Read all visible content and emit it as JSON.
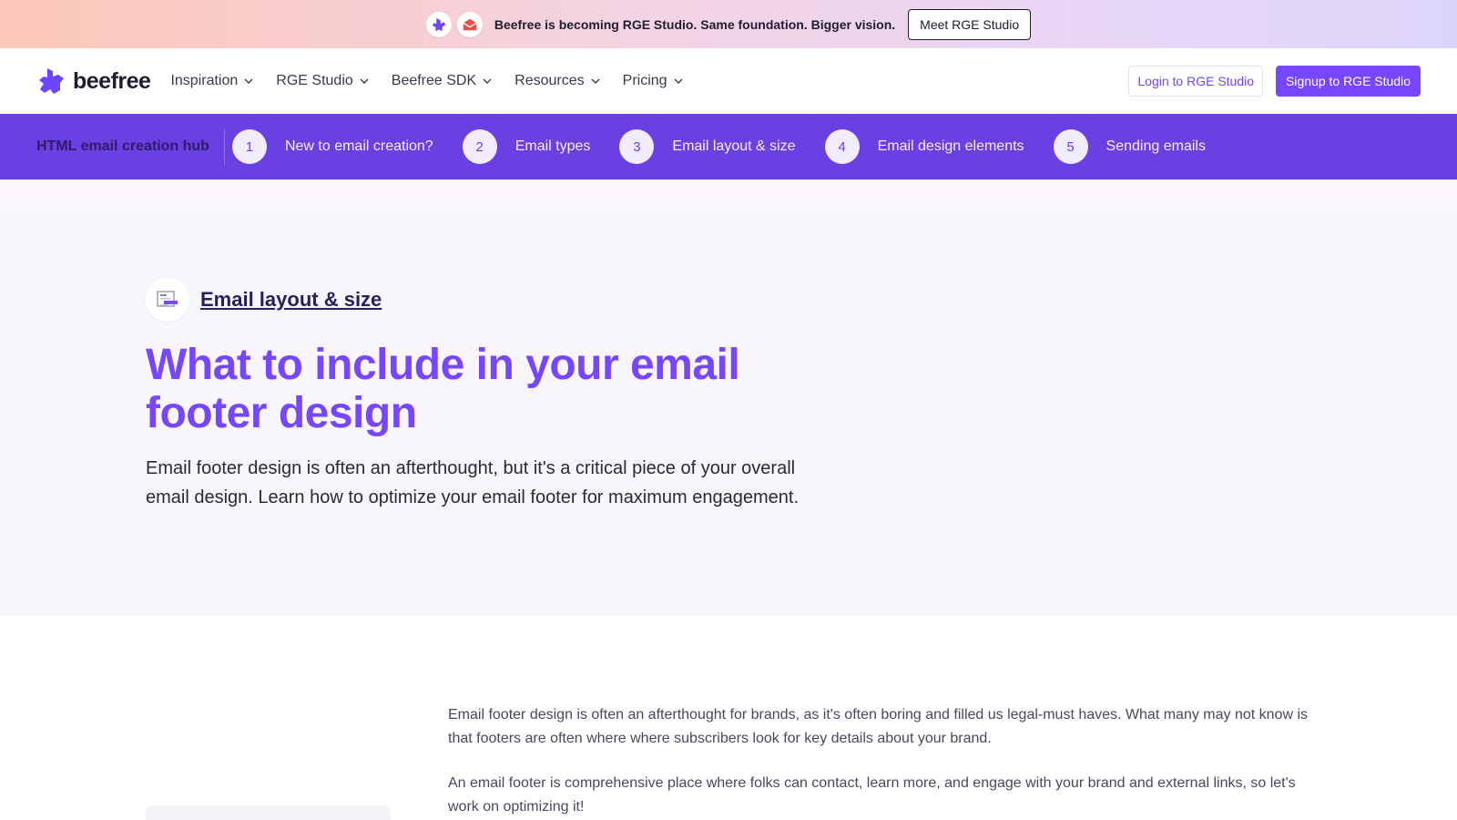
{
  "announcement": {
    "message": "Beefree is becoming RGE Studio. Same foundation. Bigger vision.",
    "cta": "Meet RGE Studio"
  },
  "nav": {
    "brand": "beefree",
    "items": [
      {
        "label": "Inspiration"
      },
      {
        "label": "RGE Studio"
      },
      {
        "label": "Beefree SDK"
      },
      {
        "label": "Resources"
      },
      {
        "label": "Pricing"
      }
    ],
    "login": "Login to RGE Studio",
    "signup": "Signup to RGE Studio"
  },
  "hub": {
    "title": "HTML email creation hub",
    "steps": [
      {
        "num": "1",
        "label": "New to email creation?"
      },
      {
        "num": "2",
        "label": "Email types"
      },
      {
        "num": "3",
        "label": "Email layout & size"
      },
      {
        "num": "4",
        "label": "Email design elements"
      },
      {
        "num": "5",
        "label": "Sending emails"
      }
    ]
  },
  "hero": {
    "breadcrumb": "Email layout & size",
    "title": "What to include in your email footer design",
    "lead": "Email footer design is often an afterthought, but it's a critical piece of your overall email design. Learn how to optimize your email footer for maximum engagement."
  },
  "body": {
    "paragraphs": [
      "Email footer design is often an afterthought for brands, as it's often boring and filled us legal-must haves. What many may not know is that footers are often where where subscribers look for key details about your brand.",
      "An email footer is comprehensive place where folks can contact, learn more, and engage with your brand and external links, so let's work on optimizing it!"
    ]
  },
  "colors": {
    "brand_purple": "#7747ff",
    "hub_bar": "#6b40e3",
    "hero_bg": "#f8f6fc",
    "dark_text": "#201d2e"
  }
}
